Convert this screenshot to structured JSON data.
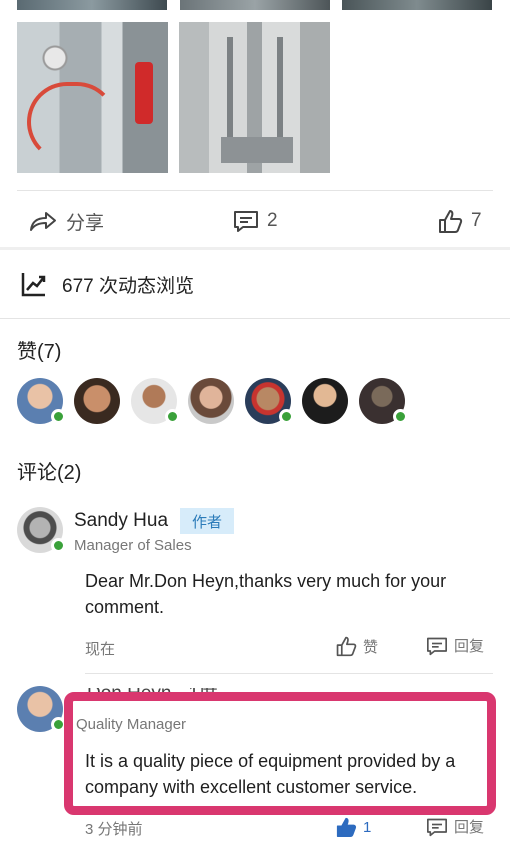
{
  "post": {
    "share_label": "分享",
    "comment_count": "2",
    "like_count": "7",
    "views_text": "677 次动态浏览"
  },
  "likes": {
    "header": "赞(7)",
    "avatars": [
      {
        "color": "#5b7fb0",
        "online": true
      },
      {
        "color": "#8a5a3c",
        "online": false
      },
      {
        "color": "#b07a58",
        "online": true
      },
      {
        "color": "#c99a88",
        "online": false
      },
      {
        "color": "#3f5a7a",
        "online": true
      },
      {
        "color": "#2c2c2c",
        "online": false
      },
      {
        "color": "#6a5a4a",
        "online": true
      }
    ]
  },
  "comments": {
    "header": "评论(2)",
    "items": [
      {
        "name": "Sandy Hua",
        "badge": "作者",
        "title": "Manager of Sales",
        "body_line1": "Dear Mr.Don Heyn,thanks very much for your",
        "body_line2": "comment.",
        "time": "现在",
        "like_label": "赞",
        "reply_label": "回复"
      },
      {
        "name": "Don Heyn · 1度",
        "title": "Quality Manager",
        "body_line1": "It is a quality piece of equipment provided by a",
        "body_line2": "company with excellent customer service.",
        "time": "3 分钟前",
        "like_count": "1",
        "reply_label": "回复"
      }
    ]
  },
  "colors": {
    "highlight": "#d9376f",
    "online_dot": "#3aa13a",
    "author_badge_bg": "#d7ecfa",
    "author_badge_text": "#2b7bb9",
    "liked_blue": "#2d6bbf"
  }
}
